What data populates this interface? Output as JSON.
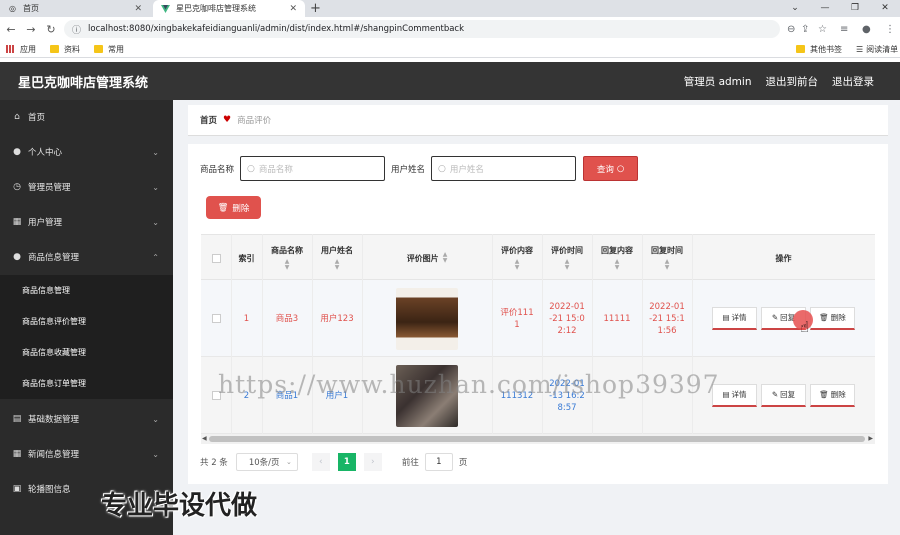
{
  "browser": {
    "tabs": [
      {
        "label": "首页",
        "icon": "globe-icon"
      },
      {
        "label": "星巴克咖啡店管理系统",
        "icon": "vue-logo-icon"
      }
    ],
    "url": "localhost:8080/xingbakekafeidianguanli/admin/dist/index.html#/shangpinCommentback",
    "bookmarks": [
      "应用",
      "资料",
      "常用"
    ],
    "bookmarks_right": [
      "其他书签",
      "阅读清单"
    ]
  },
  "header": {
    "title": "星巴克咖啡店管理系统",
    "admin_label": "管理员 admin",
    "back_front": "退出到前台",
    "logout": "退出登录"
  },
  "sidebar": {
    "items": [
      {
        "label": "首页",
        "icon": "home-icon"
      },
      {
        "label": "个人中心",
        "icon": "user-icon"
      },
      {
        "label": "管理员管理",
        "icon": "clock-icon"
      },
      {
        "label": "用户管理",
        "icon": "building-icon"
      },
      {
        "label": "商品信息管理",
        "icon": "user-icon"
      },
      {
        "label": "基础数据管理",
        "icon": "clipboard-icon"
      },
      {
        "label": "新闻信息管理",
        "icon": "grid-icon"
      },
      {
        "label": "轮播图信息",
        "icon": "image-icon"
      }
    ],
    "sub_items": [
      "商品信息管理",
      "商品信息评价管理",
      "商品信息收藏管理",
      "商品信息订单管理"
    ]
  },
  "breadcrumb": {
    "home": "首页",
    "current": "商品评价"
  },
  "search": {
    "product_label": "商品名称",
    "product_placeholder": "商品名称",
    "user_label": "用户姓名",
    "user_placeholder": "用户姓名",
    "query_button": "查询",
    "delete_button": "删除"
  },
  "table": {
    "headers": [
      "索引",
      "商品名称",
      "用户姓名",
      "评价图片",
      "评价内容",
      "评价时间",
      "回复内容",
      "回复时间",
      "操作"
    ],
    "rows": [
      {
        "index": "1",
        "product": "商品3",
        "user": "用户123",
        "content": "评价111\n1",
        "time": "2022-01\n-21 15:0\n2:12",
        "reply": "11111",
        "reply_time": "2022-01\n-21 15:1\n1:56"
      },
      {
        "index": "2",
        "product": "商品1",
        "user": "用户1",
        "content": "111312",
        "time": "2022-01\n-13 16:2\n8:57",
        "reply": "",
        "reply_time": ""
      }
    ],
    "actions": {
      "detail": "详情",
      "reply": "回复",
      "delete": "删除"
    }
  },
  "pager": {
    "total": "共 2 条",
    "page_size": "10条/页",
    "current": "1",
    "goto_label": "前往",
    "goto_value": "1",
    "page_suffix": "页"
  },
  "overlays": {
    "watermark": "https://www.huzhan.com/ishop39397",
    "caption": "专业毕设代做"
  }
}
